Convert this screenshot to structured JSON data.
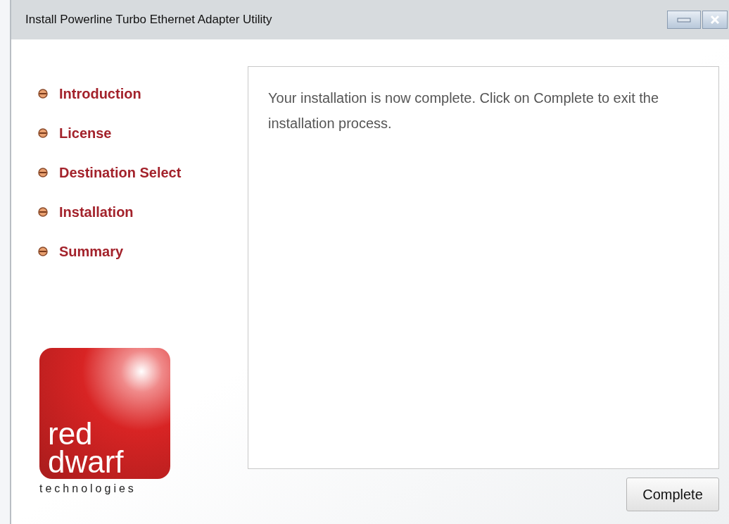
{
  "window": {
    "title": "Install Powerline Turbo Ethernet Adapter Utility"
  },
  "steps": [
    {
      "label": "Introduction"
    },
    {
      "label": "License"
    },
    {
      "label": "Destination Select"
    },
    {
      "label": "Installation"
    },
    {
      "label": "Summary"
    }
  ],
  "logo": {
    "line_1": "red",
    "line_2": "dwarf",
    "tagline": "technologies"
  },
  "message": "Your installation is now complete. Click on Complete to exit the installation process.",
  "buttons": [
    {
      "label": "Complete"
    }
  ]
}
